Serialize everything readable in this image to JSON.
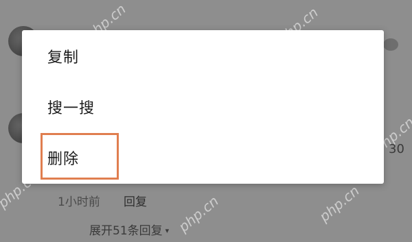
{
  "background": {
    "number_fragment": "30",
    "time_label": "1小时前",
    "reply_label": "回复",
    "expand_label": "展开51条回复",
    "expand_caret": "▾"
  },
  "menu": {
    "items": [
      {
        "label": "复制"
      },
      {
        "label": "搜一搜"
      },
      {
        "label": "删除"
      }
    ],
    "highlighted_item": "删除",
    "highlight_color": "#e07e4f"
  },
  "watermark": "php.cn"
}
